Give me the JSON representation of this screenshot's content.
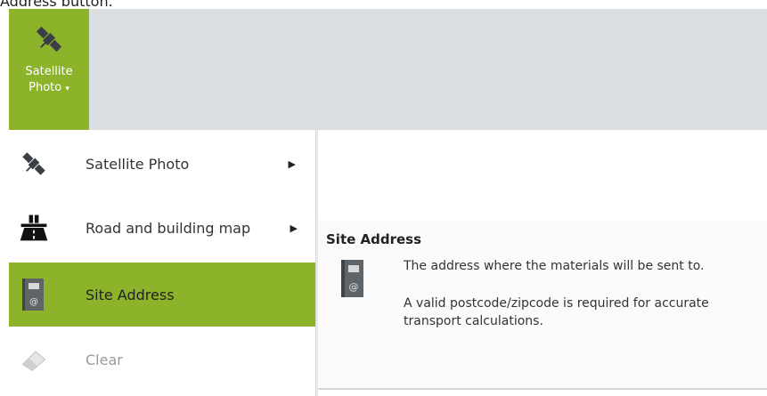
{
  "caption": "Address button.",
  "ribbon_button": {
    "label_line1": "Satellite",
    "label_line2": "Photo",
    "dropdown_glyph": "▾",
    "icon": "satellite-icon"
  },
  "menu": {
    "items": [
      {
        "label": "Satellite Photo",
        "icon": "satellite-icon",
        "has_submenu": true
      },
      {
        "label": "Road and building map",
        "icon": "road-icon",
        "has_submenu": true
      },
      {
        "label": "Site Address",
        "icon": "address-book-icon",
        "has_submenu": false,
        "active": true
      },
      {
        "label": "Clear",
        "icon": "eraser-icon",
        "has_submenu": false,
        "disabled": true
      }
    ],
    "arrow_glyph": "▶"
  },
  "tooltip": {
    "title": "Site Address",
    "line1": "The address where the materials will be sent to.",
    "line2": "A valid postcode/zipcode is required for accurate transport calculations."
  },
  "colors": {
    "accent": "#8db32b",
    "ribbon_bg": "#dcdfe2"
  }
}
